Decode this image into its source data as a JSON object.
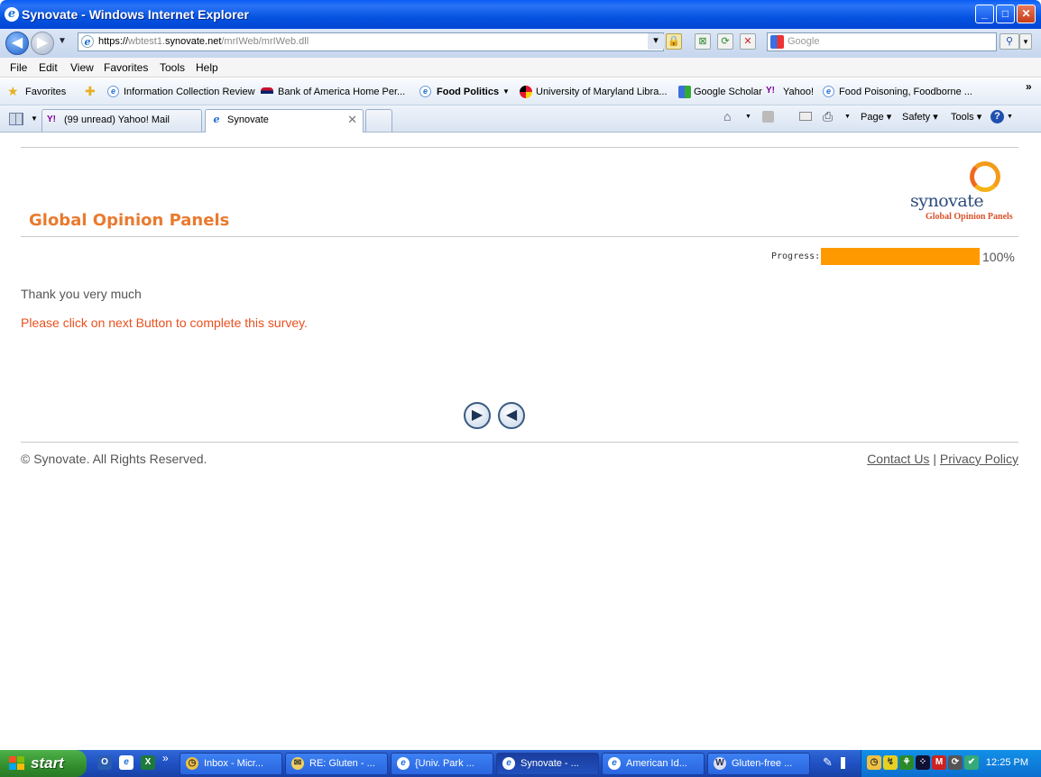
{
  "window": {
    "title": "Synovate - Windows Internet Explorer"
  },
  "address": {
    "prefix": "https://",
    "host_grey": "wbtest1.",
    "host": "synovate.net",
    "path": "/mrIWeb/mrIWeb.dll"
  },
  "search": {
    "placeholder": "Google"
  },
  "menu": [
    "File",
    "Edit",
    "View",
    "Favorites",
    "Tools",
    "Help"
  ],
  "favorites": {
    "label": "Favorites",
    "items": [
      "Information Collection Review",
      "Bank of America  Home  Per...",
      "Food Politics",
      "University of Maryland Libra...",
      "Google Scholar",
      "Yahoo!",
      "Food Poisoning, Foodborne ..."
    ]
  },
  "tabs": [
    {
      "label": "(99 unread) Yahoo! Mail"
    },
    {
      "label": "Synovate"
    }
  ],
  "commands": {
    "page": "Page",
    "safety": "Safety",
    "tools": "Tools"
  },
  "page": {
    "brand_title": "Global Opinion Panels",
    "logo_word": "synovate",
    "logo_sub": "Global Opinion Panels",
    "progress_label": "Progress:",
    "progress_value": 100,
    "progress_text": "100%",
    "thanks": "Thank you very much",
    "instruction": "Please click on next Button to complete this survey.",
    "copyright": "© Synovate. All Rights Reserved.",
    "contact": "Contact Us",
    "separator": "|",
    "privacy": "Privacy Policy"
  },
  "taskbar": {
    "start": "start",
    "tasks": [
      "Inbox - Micr...",
      "RE: Gluten - ...",
      "{Univ. Park ...",
      "Synovate - ...",
      "American Id...",
      "Gluten-free ..."
    ],
    "clock": "12:25 PM"
  },
  "colors": {
    "accent_orange": "#e97a2f",
    "progress": "#ff9900",
    "instruction": "#e8501f"
  }
}
